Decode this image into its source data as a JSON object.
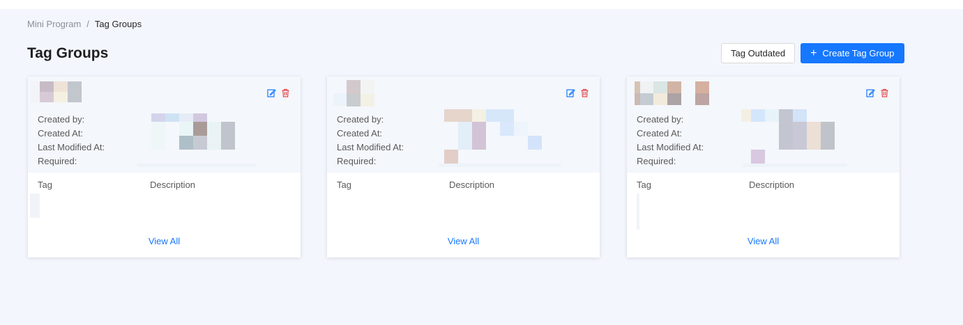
{
  "breadcrumb": {
    "items": [
      "Mini Program",
      "Tag Groups"
    ],
    "separator": "/"
  },
  "page": {
    "title": "Tag Groups"
  },
  "toolbar": {
    "tag_outdated_label": "Tag Outdated",
    "create_label": "Create Tag Group"
  },
  "card_labels": {
    "created_by": "Created by:",
    "created_at": "Created At:",
    "last_modified": "Last Modified At:",
    "required": "Required:",
    "col_tag": "Tag",
    "col_description": "Description",
    "view_all": "View All"
  },
  "colors": {
    "primary": "#1677ff",
    "edit_icon": "#1677ff",
    "delete_icon": "#e5484d",
    "page_bg": "#f3f6fc"
  },
  "icons": [
    "edit-icon",
    "delete-icon",
    "plus-icon"
  ]
}
